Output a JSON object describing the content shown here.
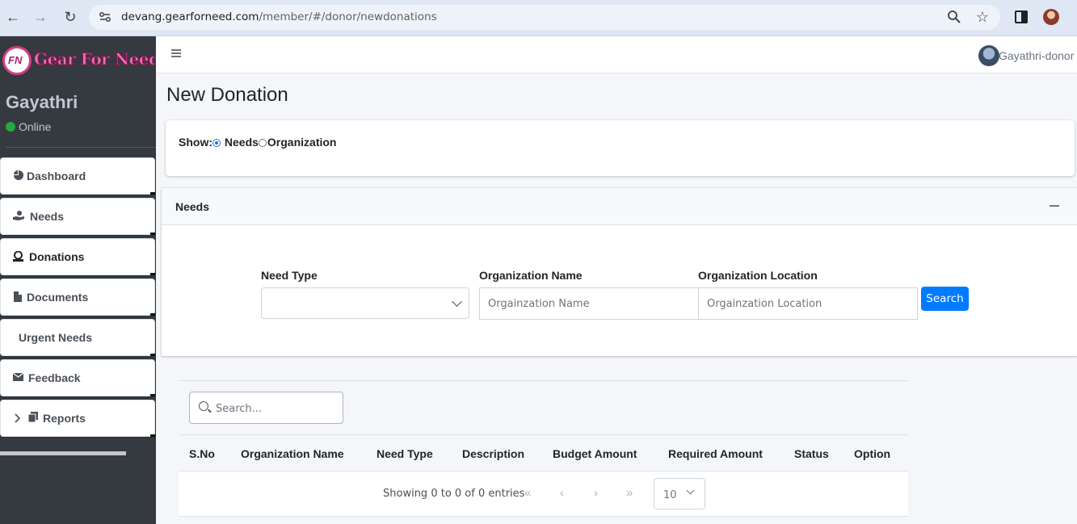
{
  "browser": {
    "url_host": "devang.gearforneed.com",
    "url_path": "/member/#/donor/newdonations"
  },
  "sidebar": {
    "brand": "Gear For Need",
    "brand_logo": "FN",
    "user_name": "Gayathri",
    "status": "Online",
    "items": [
      {
        "label": "Dashboard",
        "icon": "chart-pie-icon"
      },
      {
        "label": "Needs",
        "icon": "hand-holding-icon"
      },
      {
        "label": "Donations",
        "icon": "donate-icon"
      },
      {
        "label": "Documents",
        "icon": "file-icon"
      },
      {
        "label": "Urgent Needs",
        "icon": ""
      },
      {
        "label": "Feedback",
        "icon": "envelope-icon"
      },
      {
        "label": "Reports",
        "icon": "copy-icon"
      }
    ]
  },
  "topbar": {
    "user": "Gayathri-donor"
  },
  "page": {
    "title": "New Donation",
    "show_label": "Show:",
    "option_needs": "Needs",
    "option_organization": "Organization",
    "selected": "Needs"
  },
  "needs_card": {
    "title": "Needs",
    "need_type_label": "Need Type",
    "need_type_value": "",
    "org_name_label": "Organization Name",
    "org_name_placeholder": "Orgainzation Name",
    "org_location_label": "Organization Location",
    "org_location_placeholder": "Orgainzation Location",
    "search_button": "Search"
  },
  "table": {
    "search_placeholder": "Search...",
    "columns": [
      "S.No",
      "Organization Name",
      "Need Type",
      "Description",
      "Budget Amount",
      "Required Amount",
      "Status",
      "Option"
    ],
    "rows": [],
    "info": "Showing 0 to 0 of 0 entries",
    "page_size": "10"
  },
  "colors": {
    "sidebar_bg": "#343a40",
    "primary": "#007bff",
    "online": "#28a745",
    "brand_pink": "#f36fb3"
  }
}
